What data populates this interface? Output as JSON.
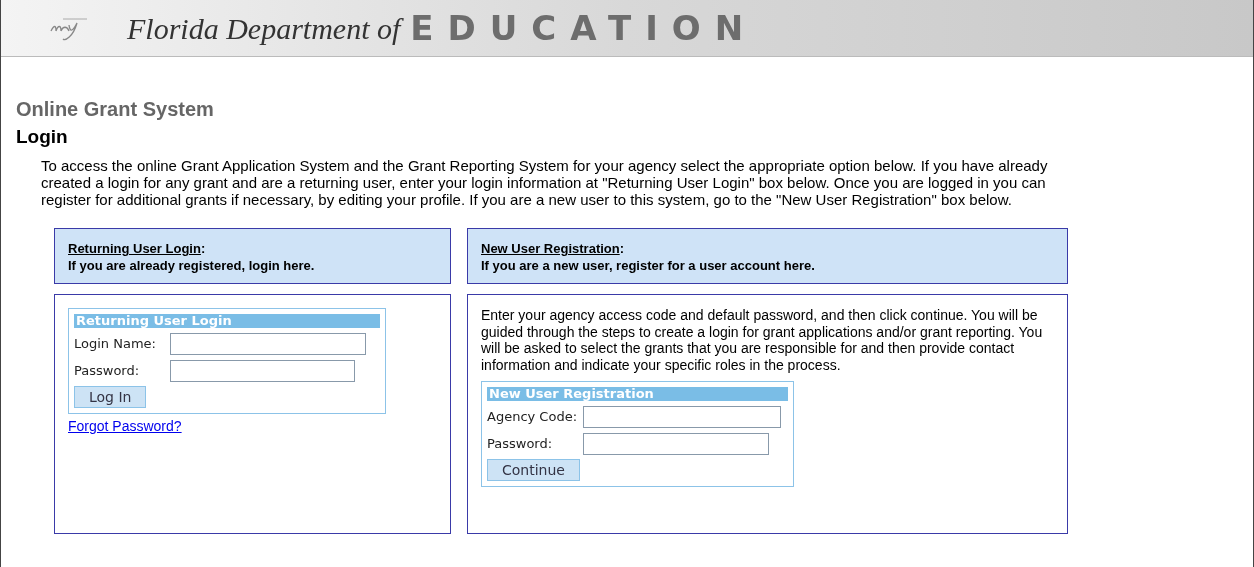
{
  "banner": {
    "script_title": "Florida Department of",
    "title": "EDUCATION"
  },
  "app_title": "Online Grant System",
  "page_title": "Login",
  "intro": "To access the online Grant Application System and the Grant Reporting System for your agency select the appropriate option below. If you have already created a login for any grant and are a returning user, enter your login information at \"Returning User Login\" box below. Once you are logged in you can register for additional grants if necessary, by editing your profile. If you are a new user to this system, go to the \"New User Registration\" box below.",
  "panels": [
    {
      "heading_link": "Returning User Login",
      "heading_suffix": ":",
      "subheading": "If you are already registered, login here.",
      "form": {
        "title": "Returning User Login",
        "fields": [
          {
            "label": "Login Name:"
          },
          {
            "label": "Password:"
          }
        ],
        "button": "Log In"
      },
      "link": "Forgot Password?"
    },
    {
      "heading_link": "New User Registration",
      "heading_suffix": ":",
      "subheading": "If you are a new user, register for a user account here.",
      "description": "Enter your agency access code and default password, and then click continue. You will be guided through the steps to create a login for grant applications and/or grant reporting. You will be asked to select the grants that you are responsible for and then provide contact information and indicate your specific roles in the process.",
      "form": {
        "title": "New User Registration",
        "fields": [
          {
            "label": "Agency Code:"
          },
          {
            "label": "Password:"
          }
        ],
        "button": "Continue"
      }
    }
  ]
}
